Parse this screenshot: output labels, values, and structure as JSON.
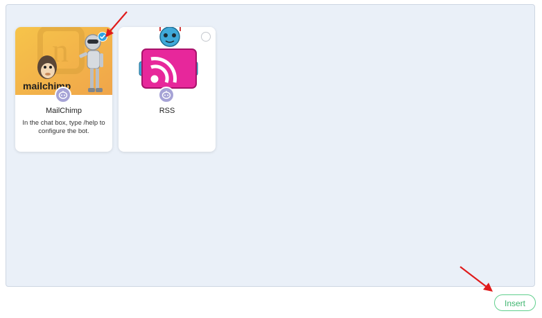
{
  "bots": [
    {
      "name": "MailChimp",
      "description": "In the chat box, type /help to configure the bot.",
      "brand_text": "mailchimp",
      "selected": true,
      "icon": "robot-mailchimp-icon"
    },
    {
      "name": "RSS",
      "description": "",
      "selected": false,
      "icon": "robot-rss-icon"
    }
  ],
  "actions": {
    "insert_label": "Insert"
  },
  "colors": {
    "panel_bg": "#eaf0f8",
    "selected_check": "#2ea3e3",
    "insert_green": "#3fb56f",
    "badge_purple": "#a6a3d6",
    "annotation_red": "#e01b1b"
  }
}
